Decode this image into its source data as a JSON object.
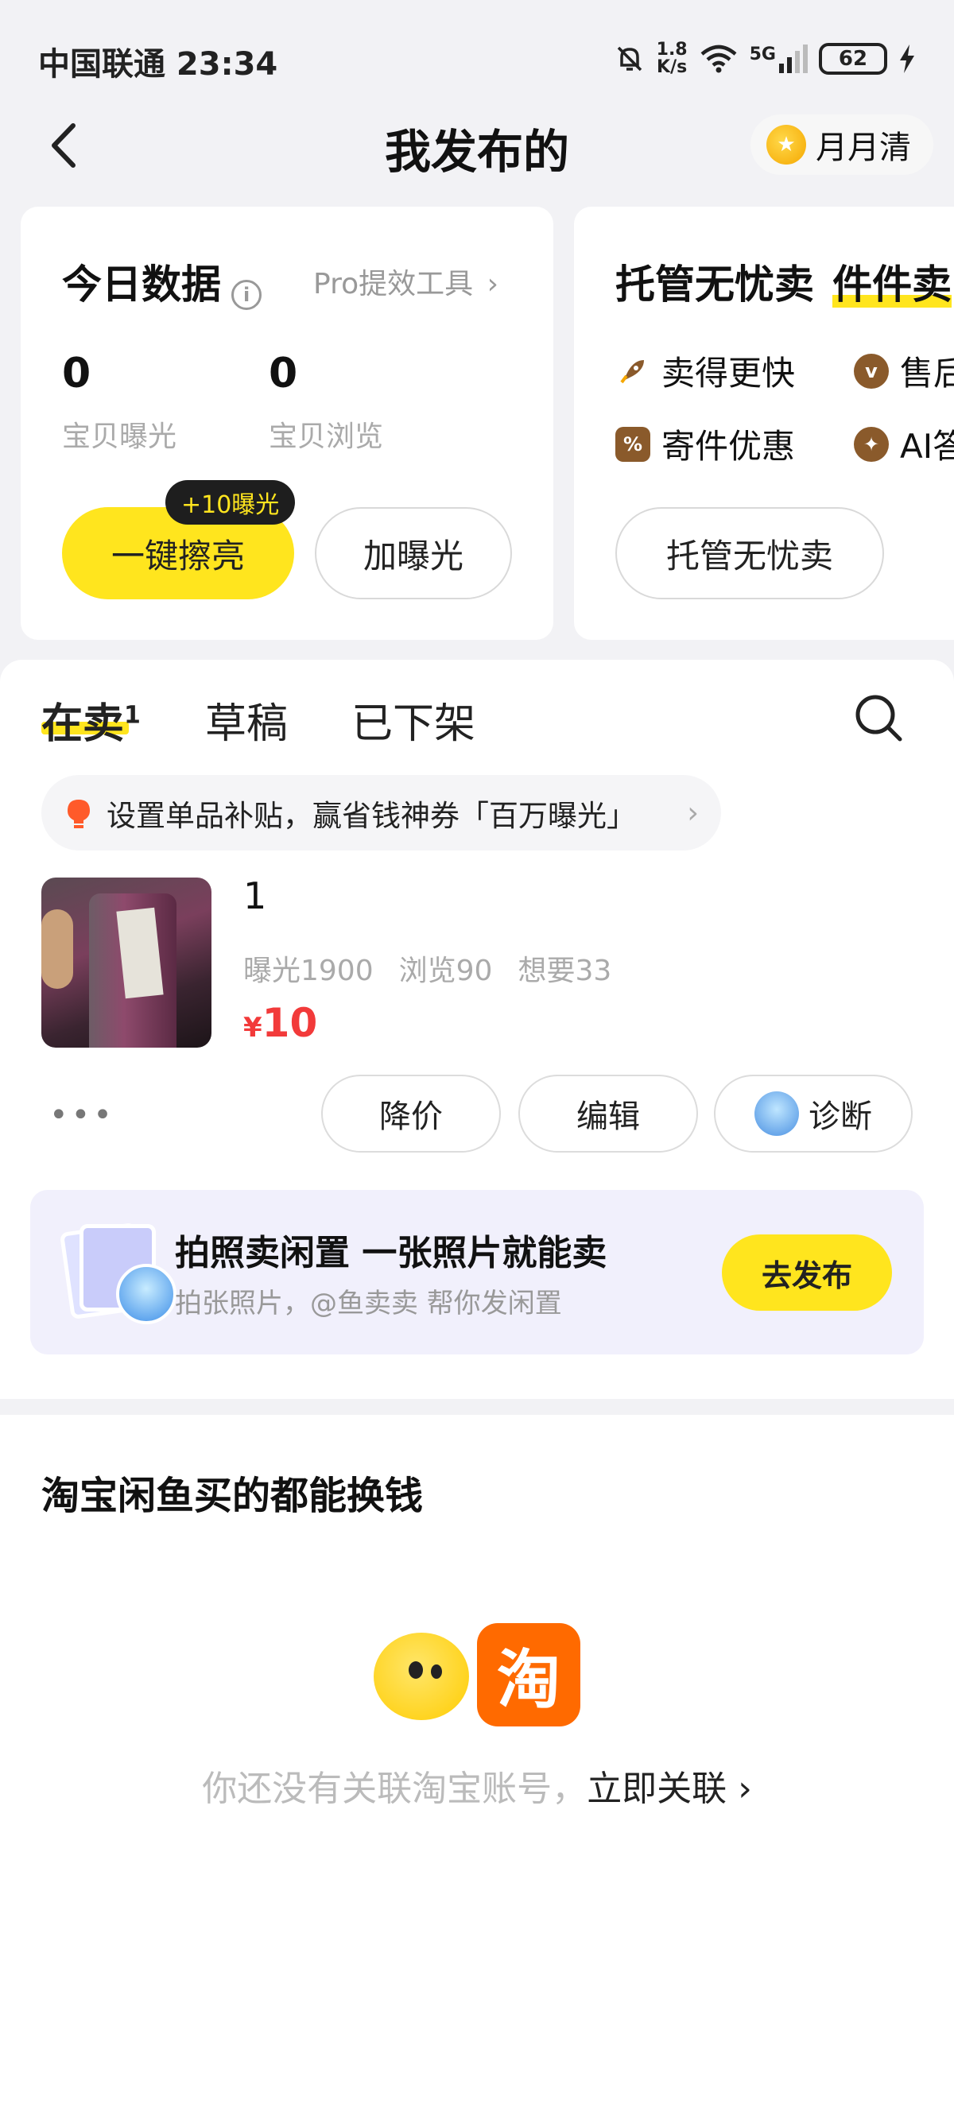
{
  "status_bar": {
    "carrier_time": "中国联通 23:34",
    "net_speed_value": "1.8",
    "net_speed_unit": "K/s",
    "network": "5G",
    "battery": "62"
  },
  "nav": {
    "title": "我发布的",
    "monthly_label": "月月清"
  },
  "today_card": {
    "title": "今日数据",
    "info_icon": "i",
    "pro_link": "Pro提效工具",
    "stats": [
      {
        "value": "0",
        "label": "宝贝曝光"
      },
      {
        "value": "0",
        "label": "宝贝浏览"
      }
    ],
    "primary_button": "一键擦亮",
    "primary_badge": "+10曝光",
    "secondary_button": "加曝光"
  },
  "managed_card": {
    "title": "托管无忧卖",
    "title_highlight": "件件卖",
    "features": [
      "卖得更快",
      "售后",
      "寄件优惠",
      "AI答"
    ],
    "button": "托管无忧卖"
  },
  "tabs": [
    {
      "label": "在卖",
      "count": "1",
      "active": true
    },
    {
      "label": "草稿",
      "active": false
    },
    {
      "label": "已下架",
      "active": false
    }
  ],
  "tip_bar": {
    "text": "设置单品补贴，赢省钱神券「百万曝光」"
  },
  "product": {
    "title": "1",
    "stats": [
      "曝光1900",
      "浏览90",
      "想要33"
    ],
    "currency": "¥",
    "price": "10",
    "more": "•••",
    "actions": [
      "降价",
      "编辑",
      "诊断"
    ]
  },
  "promo": {
    "title": "拍照卖闲置 一张照片就能卖",
    "subtitle": "拍张照片，@鱼卖卖 帮你发闲置",
    "button": "去发布"
  },
  "taobao_section": {
    "title": "淘宝闲鱼买的都能换钱",
    "logo_char": "淘",
    "notice": "你还没有关联淘宝账号，",
    "link": "立即关联",
    "link_arrow": "›"
  },
  "colors": {
    "accent_yellow": "#ffe51e",
    "price_red": "#f23a3a",
    "taobao_orange": "#ff6a00",
    "promo_bg": "#f1f0fc"
  },
  "icons": [
    "back-arrow-icon",
    "coin-icon",
    "info-icon",
    "chevron-right-icon",
    "rocket-icon",
    "headset-icon",
    "coupon-icon",
    "ai-sparkle-icon",
    "search-icon",
    "bulb-icon",
    "diagnose-avatar-icon",
    "photo-stack-icon",
    "taobao-logo-icon",
    "fish-mascot-icon"
  ]
}
